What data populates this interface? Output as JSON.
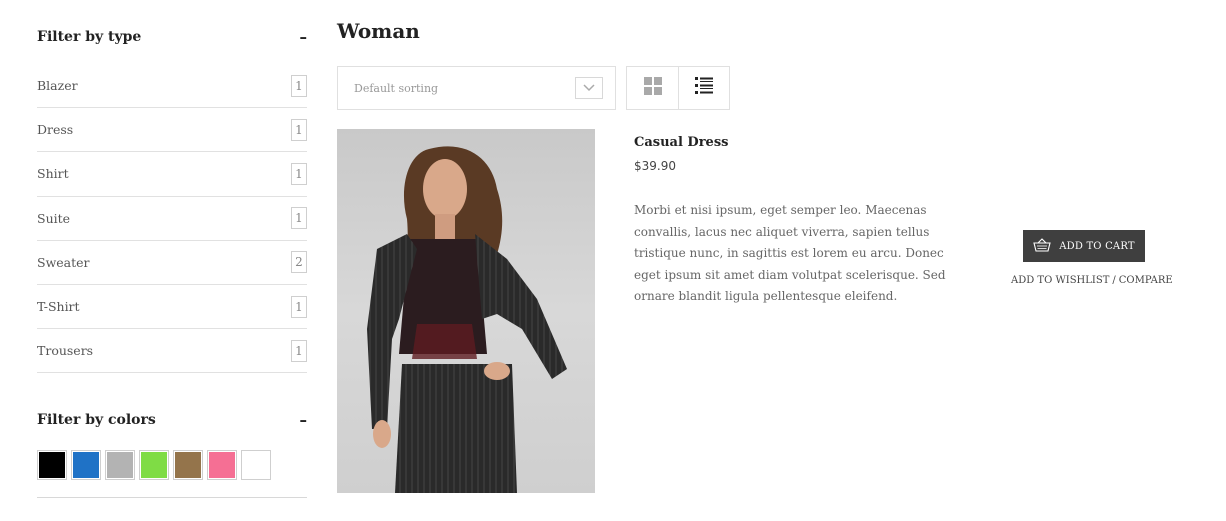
{
  "sidebar": {
    "type_filter": {
      "title": "Filter by type",
      "collapse_symbol": "–",
      "items": [
        {
          "label": "Blazer",
          "count": "1"
        },
        {
          "label": "Dress",
          "count": "1"
        },
        {
          "label": "Shirt",
          "count": "1"
        },
        {
          "label": "Suite",
          "count": "1"
        },
        {
          "label": "Sweater",
          "count": "2"
        },
        {
          "label": "T-Shirt",
          "count": "1"
        },
        {
          "label": "Trousers",
          "count": "1"
        }
      ]
    },
    "color_filter": {
      "title": "Filter by colors",
      "collapse_symbol": "–",
      "swatches": [
        "#000000",
        "#1f72c6",
        "#b3b3b3",
        "#7fdc45",
        "#94744b",
        "#f56f94",
        "#ffffff"
      ]
    }
  },
  "main": {
    "title": "Woman",
    "sorting": {
      "value": "Default sorting"
    },
    "view_modes": [
      {
        "name": "grid-view-icon"
      },
      {
        "name": "list-view-icon"
      }
    ],
    "product": {
      "name": "Casual Dress",
      "price": "$39.90",
      "description": "Morbi et nisi ipsum, eget semper leo. Maecenas convallis, lacus nec aliquet viverra, sapien tellus tristique nunc, in sagittis est lorem eu arcu. Donec eget ipsum sit amet diam volutpat scelerisque. Sed ornare blandit ligula pellentesque eleifend.",
      "add_to_cart": "ADD TO CART",
      "wishlist": "ADD TO WISHLIST",
      "separator": "/",
      "compare": "COMPARE"
    }
  }
}
